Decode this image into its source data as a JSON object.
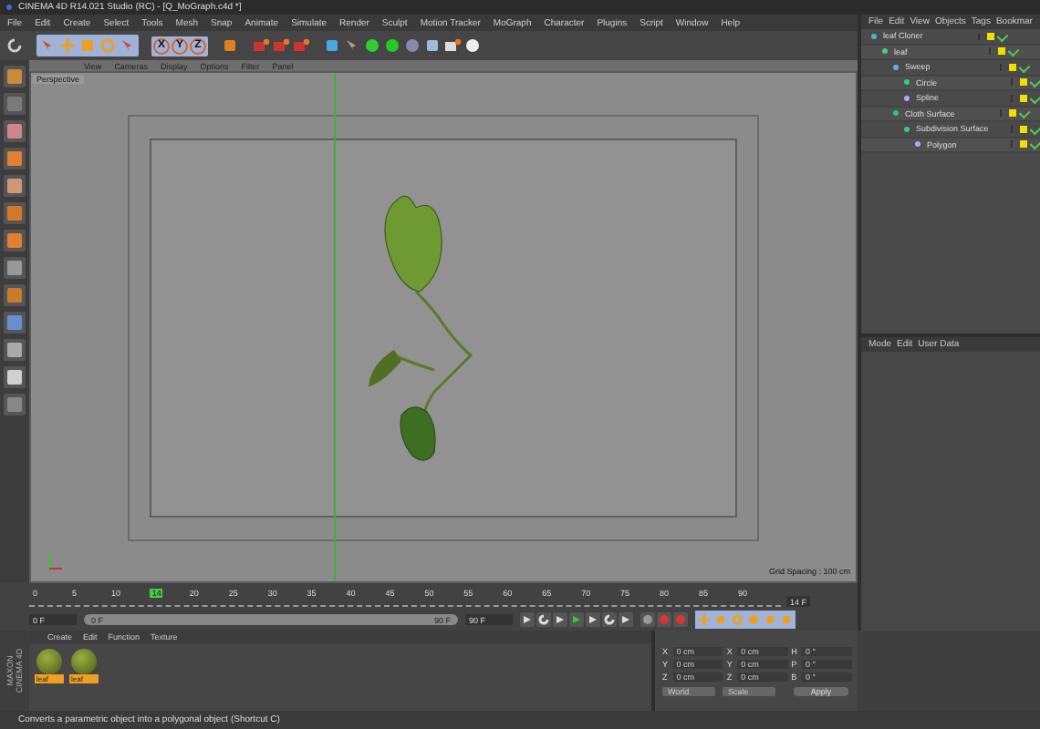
{
  "window": {
    "title": "CINEMA 4D R14.021 Studio (RC) - [Q_MoGraph.c4d *]"
  },
  "menu": [
    "File",
    "Edit",
    "Create",
    "Select",
    "Tools",
    "Mesh",
    "Snap",
    "Animate",
    "Simulate",
    "Render",
    "Sculpt",
    "Motion Tracker",
    "MoGraph",
    "Character",
    "Plugins",
    "Script",
    "Window",
    "Help"
  ],
  "toolbar": {
    "axes": [
      "X",
      "Y",
      "Z"
    ]
  },
  "viewport": {
    "menu": [
      "View",
      "Cameras",
      "Display",
      "Options",
      "Filter",
      "Panel"
    ],
    "camera": "Perspective",
    "grid_spacing": "Grid Spacing : 100 cm"
  },
  "object_manager": {
    "menu": [
      "File",
      "Edit",
      "View",
      "Objects",
      "Tags",
      "Bookmar"
    ],
    "tree": [
      {
        "name": "leaf Cloner",
        "enabled": true,
        "children": [
          {
            "name": "leaf",
            "enabled": true,
            "children": [
              {
                "name": "Sweep",
                "enabled": true,
                "children": [
                  {
                    "name": "Circle",
                    "enabled": true
                  },
                  {
                    "name": "Spline",
                    "enabled": true
                  }
                ]
              },
              {
                "name": "Cloth Surface",
                "enabled": true,
                "children": [
                  {
                    "name": "Subdivision Surface",
                    "enabled": true,
                    "children": [
                      {
                        "name": "Polygon",
                        "enabled": true
                      }
                    ]
                  }
                ]
              }
            ]
          }
        ]
      }
    ]
  },
  "attribute_manager": {
    "menu": [
      "Mode",
      "Edit",
      "User Data"
    ]
  },
  "timeline": {
    "ruler": [
      "0",
      "5",
      "10",
      "20",
      "25",
      "30",
      "35",
      "40",
      "45",
      "50",
      "55",
      "60",
      "65",
      "70",
      "75",
      "80",
      "85",
      "90"
    ],
    "playhead": {
      "label": "14",
      "level": 0.156
    },
    "current": "14 F",
    "start": "0 F",
    "range": {
      "start": "0 F",
      "end": "90 F",
      "level": 1
    },
    "end": "90 F"
  },
  "material_manager": {
    "menu": [
      "Create",
      "Edit",
      "Function",
      "Texture"
    ],
    "materials": [
      {
        "name": "leaf"
      },
      {
        "name": "leaf"
      }
    ]
  },
  "logo": [
    "MAXON",
    "CINEMA 4D"
  ],
  "coordinates": {
    "rows": [
      {
        "axis": "X",
        "position": "0 cm",
        "size_axis": "X",
        "size": "0 cm",
        "rot_axis": "H",
        "rotation": "0 °"
      },
      {
        "axis": "Y",
        "position": "0 cm",
        "size_axis": "Y",
        "size": "0 cm",
        "rot_axis": "P",
        "rotation": "0 °"
      },
      {
        "axis": "Z",
        "position": "0 cm",
        "size_axis": "Z",
        "size": "0 cm",
        "rot_axis": "B",
        "rotation": "0 °"
      }
    ],
    "mode": "World",
    "size_mode": "Scale",
    "apply": "Apply"
  },
  "status_bar": "Converts a parametric object into a polygonal object (Shortcut C)"
}
